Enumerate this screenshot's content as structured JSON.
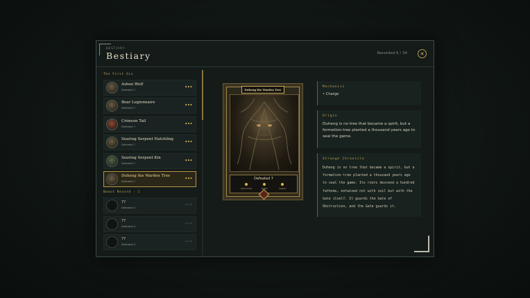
{
  "header": {
    "kicker": "BESTIARY",
    "title": "Bestiary",
    "recorded": "Recorded 6 / 34",
    "close_icon": "close-x-icon"
  },
  "sections": [
    {
      "label": "The First Six",
      "items": [
        {
          "name": "Ashen Wolf",
          "sub": "Defeated 7",
          "avatar": "brown",
          "selected": false
        },
        {
          "name": "Bear Legionnaire",
          "sub": "Defeated 7",
          "avatar": "brown",
          "selected": false
        },
        {
          "name": "Crimson Tail",
          "sub": "Defeated 7",
          "avatar": "red",
          "selected": false
        },
        {
          "name": "Searing Serpent Hatchling",
          "sub": "Defeated 7",
          "avatar": "brown",
          "selected": false
        },
        {
          "name": "Searing Serpent Kin",
          "sub": "Defeated 7",
          "avatar": "green",
          "selected": false
        },
        {
          "name": "Duheng the Warden Tree",
          "sub": "Defeated 7",
          "avatar": "brown",
          "selected": true
        }
      ]
    },
    {
      "label": "Beast Record · 1",
      "items": [
        {
          "name": "??",
          "sub": "Defeated 0",
          "avatar": "dark",
          "selected": false
        },
        {
          "name": "??",
          "sub": "Defeated 0",
          "avatar": "dark",
          "selected": false
        },
        {
          "name": "??",
          "sub": "Defeated 0",
          "avatar": "dark",
          "selected": false
        }
      ]
    }
  ],
  "more_icon": "•••",
  "card": {
    "title": "Duheng the Warden Tree",
    "footer": "Defeated 7",
    "stats": [
      "Summoned",
      "Tested",
      "Sealed"
    ]
  },
  "mechanics": {
    "title": "Mechanics",
    "items": [
      "Charge"
    ]
  },
  "origin": {
    "title": "Origin",
    "text": "Duheng is no tree that became a spirit, but a formation-tree planted a thousand years ago to seal the game."
  },
  "chronicle": {
    "title": "Strange Chronicle",
    "lines": [
      "Duheng is no tree that became a spirit, but a",
      "formation-tree planted a thousand years ago",
      "to seal the game. Its roots descend a hundred",
      "fathoms, entwined not with soil but with the",
      "Gate itself. It guards the Gate of",
      "Obstruction, and the Gate guards it."
    ]
  },
  "colors": {
    "accent_gold": "#c9a95a",
    "selected_bg": "#2a2718",
    "panel_bg": "#141b19"
  }
}
